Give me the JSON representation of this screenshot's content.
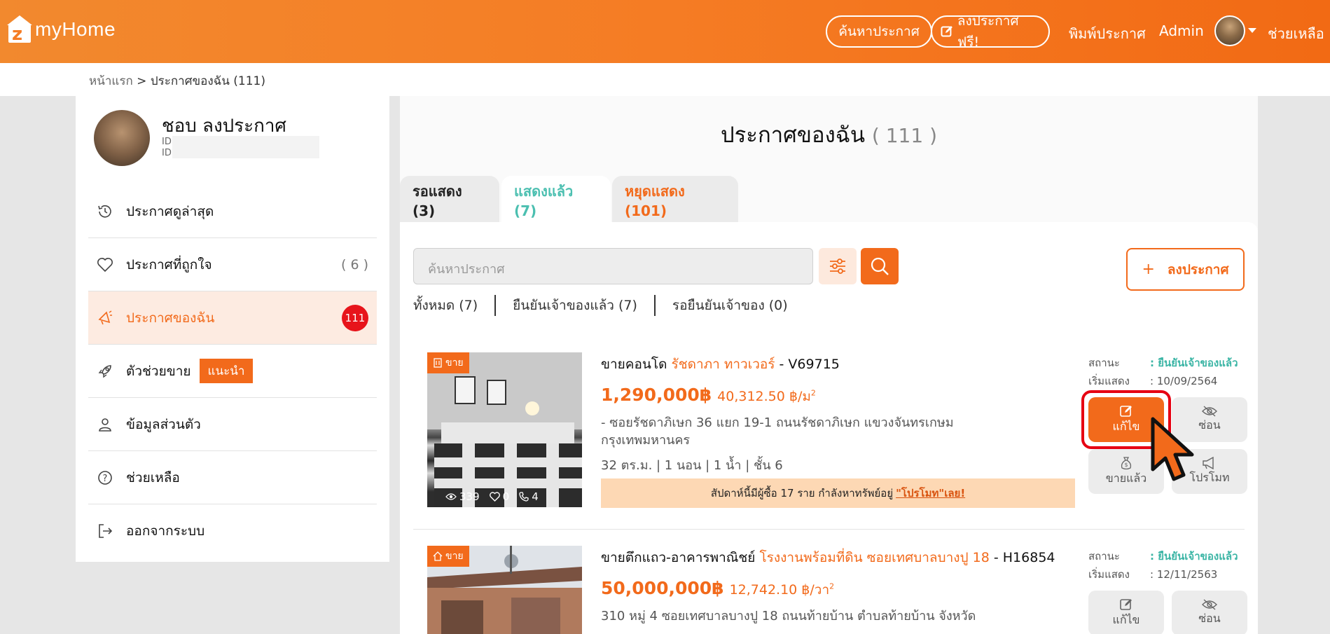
{
  "header": {
    "logo_text": "myHome",
    "search_btn": "ค้นหาประกาศ",
    "post_free_btn": "ลงประกาศฟรี!",
    "print_link": "พิมพ์ประกาศ",
    "user_link": "Admin",
    "help_link": "ช่วยเหลือ",
    "brand_color": "#f57c24"
  },
  "breadcrumb": {
    "home": "หน้าแรก",
    "sep": ">",
    "current": "ประกาศของฉัน (111)"
  },
  "profile": {
    "name": "ชอบ ลงประกาศ",
    "id1": "ID:",
    "id2": "ID:"
  },
  "sidebar": {
    "items": [
      {
        "label": "ประกาศดูล่าสุด",
        "icon": "history-icon"
      },
      {
        "label": "ประกาศที่ถูกใจ",
        "icon": "heart-icon",
        "count": "( 6 )"
      },
      {
        "label": "ประกาศของฉัน",
        "icon": "megaphone-icon",
        "badge": "111"
      },
      {
        "label": "ตัวช่วยขาย",
        "icon": "rocket-icon",
        "tag": "แนะนำ"
      },
      {
        "label": "ข้อมูลส่วนตัว",
        "icon": "user-icon"
      },
      {
        "label": "ช่วยเหลือ",
        "icon": "question-icon"
      },
      {
        "label": "ออกจากระบบ",
        "icon": "logout-icon"
      }
    ]
  },
  "main": {
    "title": "ประกาศของฉัน",
    "title_count": "( 111 )",
    "tabs": [
      {
        "label": "รอแสดง (3)"
      },
      {
        "label": "แสดงแล้ว (7)"
      },
      {
        "label": "หยุดแสดง (101)"
      }
    ],
    "search_placeholder": "ค้นหาประกาศ",
    "post_btn": "ลงประกาศ",
    "filters": [
      "ทั้งหมด (7)",
      "ยืนยันเจ้าของแล้ว (7)",
      "รอยืนยันเจ้าของ (0)"
    ]
  },
  "listings": [
    {
      "tag": "ขาย",
      "type": "ขายคอนโด",
      "project": "รัชดาภา ทาวเวอร์",
      "code": "- V69715",
      "price": "1,290,000฿",
      "unit_price": "40,312.50 ฿/ม",
      "unit_sup": "2",
      "address": "- ซอยรัชดาภิเษก 36 แยก 19-1 ถนนรัชดาภิเษก แขวงจันทรเกษม กรุงเทพมหานคร",
      "specs": "32 ตร.ม. | 1 นอน | 1 น้ำ | ชั้น 6",
      "views": "339",
      "likes": "0",
      "calls": "4",
      "promo_text": "สัปดาห์นี้มีผู้ซื้อ 17 ราย กำลังหาทรัพย์อยู่",
      "promo_link": "\"โปรโมท\"เลย!",
      "status_label": "สถานะ",
      "status_value": ": ยืนยันเจ้าของแล้ว",
      "start_label": "เริ่มแสดง",
      "start_value": ": 10/09/2564",
      "actions": {
        "edit": "แก้ไข",
        "hide": "ซ่อน",
        "sold": "ขายแล้ว",
        "promote": "โปรโมท"
      }
    },
    {
      "tag": "ขาย",
      "type": "ขายตึกแถว-อาคารพาณิชย์",
      "project": "โรงงานพร้อมที่ดิน ซอยเทศบาลบางปู 18",
      "code": "- H16854",
      "price": "50,000,000฿",
      "unit_price": "12,742.10 ฿/วา",
      "unit_sup": "2",
      "address": "310 หมู่ 4 ซอยเทศบาลบางปู 18 ถนนท้ายบ้าน ตำบลท้ายบ้าน จังหวัด",
      "status_label": "สถานะ",
      "status_value": ": ยืนยันเจ้าของแล้ว",
      "start_label": "เริ่มแสดง",
      "start_value": ": 12/11/2563",
      "actions": {
        "edit": "แก้ไข",
        "hide": "ซ่อน"
      }
    }
  ]
}
